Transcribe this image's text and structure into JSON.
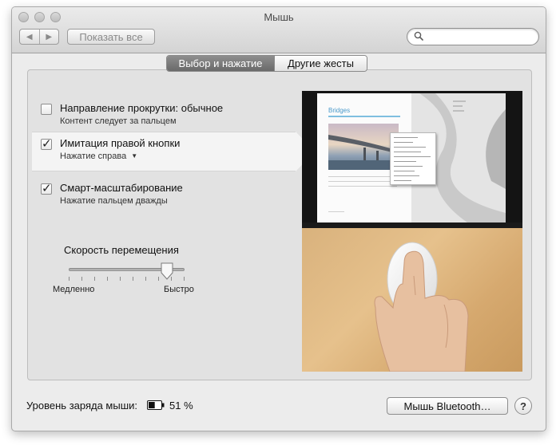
{
  "window": {
    "title": "Мышь",
    "nav_back_icon": "◀",
    "nav_forward_icon": "▶",
    "show_all_label": "Показать все",
    "search_placeholder": ""
  },
  "tabs": [
    {
      "label": "Выбор и нажатие",
      "active": true
    },
    {
      "label": "Другие жесты",
      "active": false
    }
  ],
  "options": [
    {
      "title": "Направление прокрутки: обычное",
      "subtitle": "Контент следует за пальцем",
      "checked": false
    },
    {
      "title": "Имитация правой кнопки",
      "subtitle": "Нажатие справа",
      "checked": true,
      "has_dropdown": true
    },
    {
      "title": "Смарт-масштабирование",
      "subtitle": "Нажатие пальцем дважды",
      "checked": true
    }
  ],
  "checkmark_glyph": "✓",
  "dropdown_glyph": "▼",
  "speed": {
    "title": "Скорость перемещения",
    "min_label": "Медленно",
    "max_label": "Быстро",
    "value_fraction": 0.85,
    "tick_count": 10
  },
  "preview": {
    "document_title": "Bridges"
  },
  "footer": {
    "battery_label": "Уровень заряда мыши:",
    "battery_percent": "51 %",
    "battery_level": 0.51,
    "bluetooth_button": "Мышь Bluetooth…",
    "help_button": "?"
  },
  "colors": {
    "active_tab": "#7a7a7a",
    "link_blue": "#4a9acb"
  }
}
